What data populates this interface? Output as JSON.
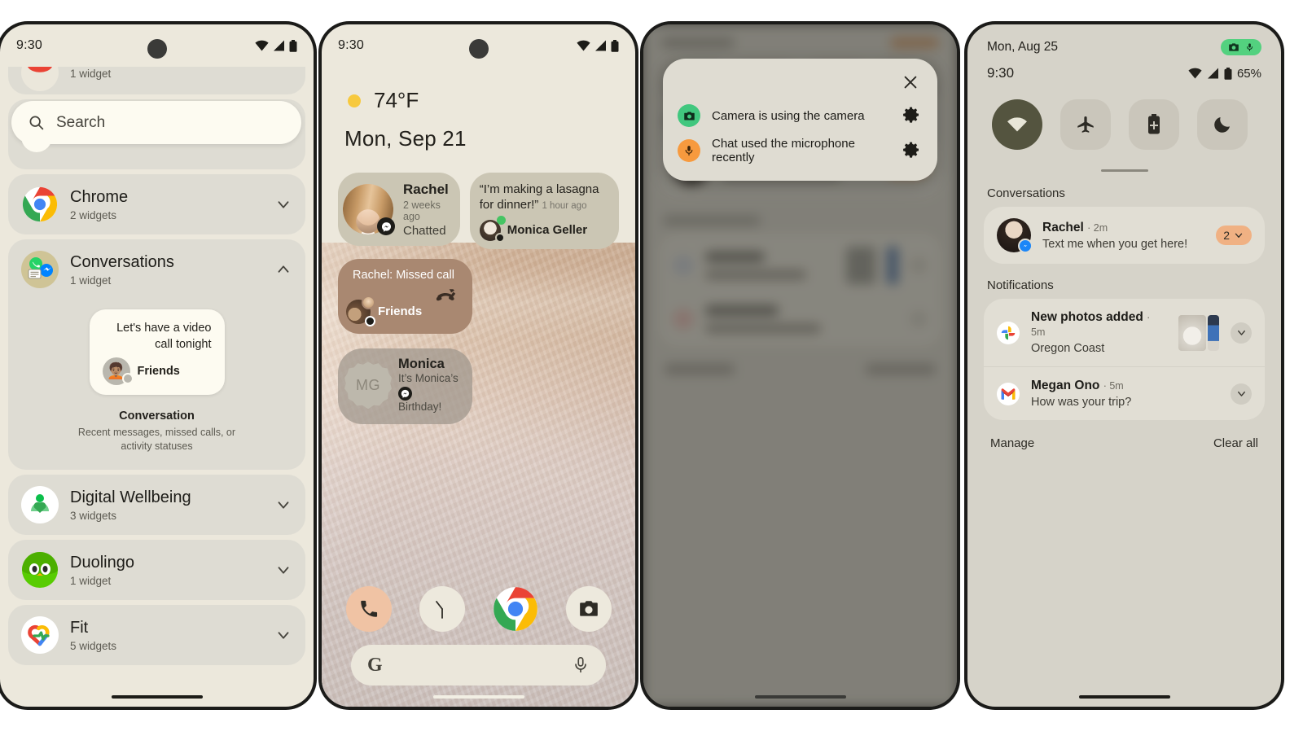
{
  "panel1": {
    "name": "widget-picker",
    "statusbar": {
      "time": "9:30"
    },
    "search": {
      "placeholder": "Search",
      "value": "Search"
    },
    "clipped_item": {
      "subtitle": "1 widget"
    },
    "items": [
      {
        "title": "Chrome",
        "subtitle": "2 widgets",
        "chevron": "chevron-down"
      },
      {
        "title": "Conversations",
        "subtitle": "1 widget",
        "chevron": "chevron-up"
      },
      {
        "title": "Digital Wellbeing",
        "subtitle": "3 widgets",
        "chevron": "chevron-down"
      },
      {
        "title": "Duolingo",
        "subtitle": "1 widget",
        "chevron": "chevron-down"
      },
      {
        "title": "Fit",
        "subtitle": "5 widgets",
        "chevron": "chevron-down"
      }
    ],
    "preview": {
      "message": "Let's have a video call tonight",
      "person": "Friends",
      "widget_name": "Conversation",
      "widget_desc": "Recent messages, missed calls, or activity statuses"
    }
  },
  "panel2": {
    "name": "home-screen",
    "statusbar": {
      "time": "9:30"
    },
    "weather": {
      "temp": "74°F",
      "icon": "sun-icon"
    },
    "date": "Mon, Sep 21",
    "conversations": [
      {
        "name": "Rachel",
        "meta": "2 weeks ago",
        "state": "Chatted"
      },
      {
        "quote": "“I’m making a lasagna for dinner!”",
        "ago": "1 hour ago",
        "name": "Monica Geller"
      },
      {
        "title": "Rachel: Missed call",
        "person": "Friends"
      },
      {
        "name": "Monica",
        "sub_line1": "It’s Monica’s",
        "sub_line2": "Birthday!",
        "initials": "MG"
      }
    ],
    "dock": [
      {
        "name": "phone-app",
        "icon": "phone-icon"
      },
      {
        "name": "clock-app",
        "icon": "clock-icon"
      },
      {
        "name": "chrome-app",
        "icon": "chrome-icon"
      },
      {
        "name": "camera-app",
        "icon": "camera-icon"
      }
    ],
    "searchbar": {
      "logo": "G",
      "mic": "mic-icon"
    }
  },
  "panel3": {
    "name": "privacy-indicator-dialog",
    "close_label": "✕",
    "items": [
      {
        "text": "Camera is using the camera",
        "icon": "camera-icon",
        "color": "#41c77e",
        "action": "gear-icon"
      },
      {
        "text": "Chat used the microphone recently",
        "icon": "mic-icon",
        "color": "#f79a3e",
        "action": "gear-icon"
      }
    ]
  },
  "panel4": {
    "name": "notification-shade",
    "date": "Mon, Aug 25",
    "time": "9:30",
    "battery": "65%",
    "privacy_chip": {
      "icons": [
        "camera-icon",
        "mic-icon"
      ],
      "color": "#53d17f"
    },
    "tiles": [
      {
        "name": "wifi",
        "icon": "wifi-icon",
        "active": true
      },
      {
        "name": "airplane-mode",
        "icon": "airplane-icon",
        "active": false
      },
      {
        "name": "battery-saver",
        "icon": "battery-plus-icon",
        "active": false
      },
      {
        "name": "do-not-disturb",
        "icon": "moon-icon",
        "active": false
      }
    ],
    "sections": {
      "conversations": "Conversations",
      "notifications": "Notifications"
    },
    "conversation": {
      "name": "Rachel",
      "time": "2m",
      "text": "Text me when you get here!",
      "count": "2"
    },
    "notifications": [
      {
        "app": "photos",
        "title": "New photos added",
        "time": "5m",
        "text": "Oregon Coast"
      },
      {
        "app": "gmail",
        "title": "Megan Ono",
        "time": "5m",
        "text": "How was your trip?"
      }
    ],
    "actions": {
      "manage": "Manage",
      "clear": "Clear all"
    }
  }
}
